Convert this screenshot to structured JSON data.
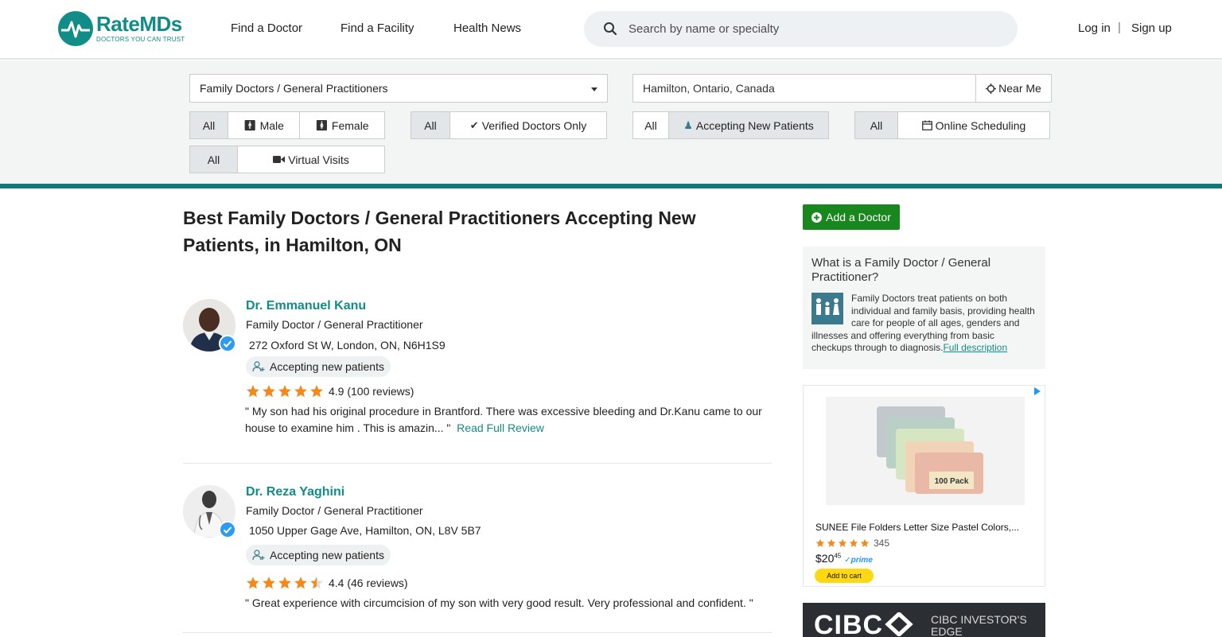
{
  "header": {
    "logo_text": "RateMDs",
    "logo_tagline": "DOCTORS YOU CAN TRUST",
    "nav": [
      "Find a Doctor",
      "Find a Facility",
      "Health News"
    ],
    "search_placeholder": "Search by name or specialty",
    "login": "Log in",
    "separator": "|",
    "signup": "Sign up"
  },
  "filters": {
    "specialty": "Family Doctors / General Practitioners",
    "location_value": "Hamilton, Ontario, Canada",
    "near_me": "Near Me",
    "gender": [
      "All",
      "Male",
      "Female"
    ],
    "verified": [
      "All",
      "Verified Doctors Only"
    ],
    "accepting": [
      "All",
      "Accepting New Patients"
    ],
    "scheduling": [
      "All",
      "Online Scheduling"
    ],
    "virtual": [
      "All",
      "Virtual Visits"
    ]
  },
  "main": {
    "title": "Best Family Doctors / General Practitioners Accepting New Patients, in Hamilton, ON",
    "doctors": [
      {
        "name": "Dr. Emmanuel Kanu",
        "specialty": "Family Doctor / General Practitioner",
        "address": "272 Oxford St W, London, ON, N6H1S9",
        "badge": "Accepting new patients",
        "rating": 4.9,
        "rating_text": "4.9 (100 reviews)",
        "review": "\" My son had his original procedure in Brantford. There was excessive bleeding and Dr.Kanu came to our house to examine him . This is amazin... \"",
        "read_more": "Read Full Review"
      },
      {
        "name": "Dr. Reza Yaghini",
        "specialty": "Family Doctor / General Practitioner",
        "address": "1050 Upper Gage Ave, Hamilton, ON, L8V 5B7",
        "badge": "Accepting new patients",
        "rating": 4.4,
        "rating_text": "4.4 (46 reviews)",
        "review": "\" Great experience with circumcision of my son with very good result. Very professional and confident. \"",
        "read_more": ""
      }
    ]
  },
  "sidebar": {
    "add_doctor": "Add a Doctor",
    "info_title": "What is a Family Doctor / General Practitioner?",
    "info_body": "Family Doctors treat patients on both individual and family basis, providing health care for people of all ages, genders and illnesses and offering everything from basic checkups through to diagnosis.",
    "info_link": "Full description",
    "ad": {
      "title": "SUNEE File Folders Letter Size Pastel Colors,...",
      "reviews": "345",
      "price_dollars": "$20",
      "price_cents": "45",
      "prime": "prime",
      "cart": "Add to cart",
      "pack_label": "100 Pack"
    },
    "banner": {
      "logo": "CIBC",
      "text": "CIBC INVESTOR'S EDGE"
    }
  },
  "colors": {
    "brand": "#128c87",
    "rule": "#117a78",
    "star": "#f28a1b",
    "add_button": "#18871e",
    "verified": "#2d9bf0"
  }
}
